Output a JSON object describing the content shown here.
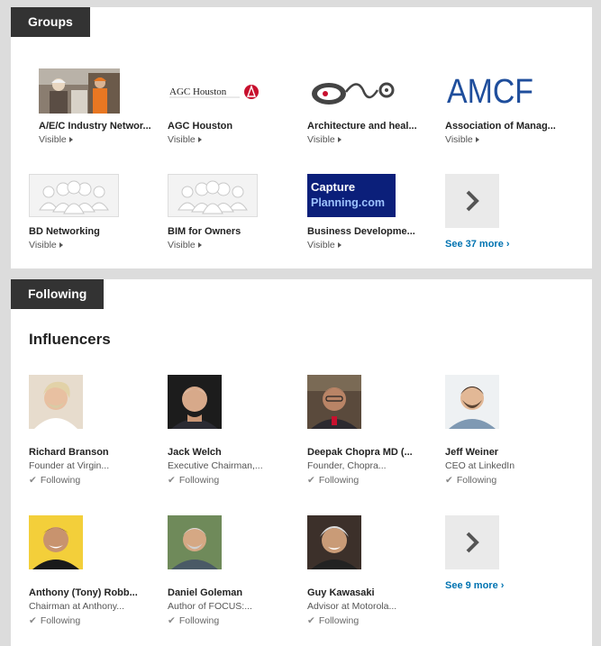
{
  "groups": {
    "header": "Groups",
    "items": [
      {
        "title": "A/E/C Industry Networ...",
        "sub": "Visible",
        "icon": "construction-workers-photo"
      },
      {
        "title": "AGC Houston",
        "sub": "Visible",
        "icon": "agc-houston-logo",
        "logo_text": "AGC Houston"
      },
      {
        "title": "Architecture and heal...",
        "sub": "Visible",
        "icon": "stethoscope-logo"
      },
      {
        "title": "Association of Manag...",
        "sub": "Visible",
        "icon": "amcf-logo",
        "logo_text": "AMCF"
      },
      {
        "title": "BD Networking",
        "sub": "Visible",
        "icon": "group-placeholder-icon"
      },
      {
        "title": "BIM for Owners",
        "sub": "Visible",
        "icon": "group-placeholder-icon"
      },
      {
        "title": "Business Developme...",
        "sub": "Visible",
        "icon": "capture-planning-logo",
        "logo_line1": "Capture",
        "logo_line2": "Planning.com"
      }
    ],
    "see_more": "See 37 more"
  },
  "following": {
    "header": "Following",
    "influencers_title": "Influencers",
    "status_label": "Following",
    "people": [
      {
        "name": "Richard Branson",
        "title": "Founder at Virgin..."
      },
      {
        "name": "Jack Welch",
        "title": "Executive Chairman,..."
      },
      {
        "name": "Deepak Chopra MD (...",
        "title": "Founder, Chopra..."
      },
      {
        "name": "Jeff Weiner",
        "title": "CEO at LinkedIn"
      },
      {
        "name": "Anthony (Tony) Robb...",
        "title": "Chairman at Anthony..."
      },
      {
        "name": "Daniel Goleman",
        "title": "Author of FOCUS:..."
      },
      {
        "name": "Guy Kawasaki",
        "title": "Advisor at Motorola..."
      }
    ],
    "see_more": "See 9 more"
  },
  "colors": {
    "tab_bg": "#333333",
    "link": "#0073b1",
    "amcf_blue": "#1f4e9c",
    "capture_bg": "#0b1f7a"
  }
}
